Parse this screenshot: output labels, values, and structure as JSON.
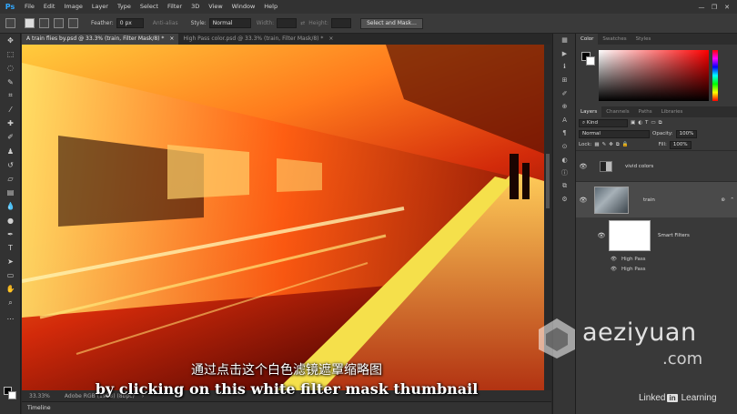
{
  "app": {
    "logo": "Ps",
    "menu": [
      "File",
      "Edit",
      "Image",
      "Layer",
      "Type",
      "Select",
      "Filter",
      "3D",
      "View",
      "Window",
      "Help"
    ],
    "window_controls": [
      "—",
      "❐",
      "✕"
    ]
  },
  "options": {
    "feather_label": "Feather:",
    "feather_value": "0 px",
    "anti_alias": "Anti-alias",
    "style_label": "Style:",
    "style_value": "Normal",
    "width_label": "Width:",
    "height_label": "Height:",
    "select_mask_label": "Select and Mask..."
  },
  "tools": [
    "move-icon",
    "marquee-icon",
    "lasso-icon",
    "quick-select-icon",
    "crop-icon",
    "eyedropper-icon",
    "healing-icon",
    "brush-icon",
    "clone-stamp-icon",
    "history-brush-icon",
    "eraser-icon",
    "gradient-icon",
    "blur-icon",
    "dodge-icon",
    "pen-icon",
    "type-icon",
    "path-select-icon",
    "shape-icon",
    "hand-icon",
    "zoom-icon",
    "more-icon"
  ],
  "documents": {
    "tabs": [
      {
        "label": "A train flies by.psd @ 33.3% (train, Filter Mask/8) *",
        "close": "×",
        "active": true
      },
      {
        "label": "High Pass color.psd @ 33.3% (train, Filter Mask/8) *",
        "close": "×",
        "active": false
      }
    ]
  },
  "status": {
    "zoom": "33.33%",
    "profile": "Adobe RGB (1998) (8bpc)",
    "arrow": "›"
  },
  "timeline_label": "Timeline",
  "color_panel": {
    "tabs": [
      "Color",
      "Swatches",
      "Styles"
    ],
    "foreground": "#000000",
    "background": "#ffffff"
  },
  "layers_panel": {
    "tabs": [
      "Layers",
      "Channels",
      "Paths",
      "Libraries"
    ],
    "kind_label": "Kind",
    "blend_mode": "Normal",
    "opacity_label": "Opacity:",
    "opacity_value": "100%",
    "lock_label": "Lock:",
    "fill_label": "Fill:",
    "fill_value": "100%",
    "layers": [
      {
        "name": "vivid colors",
        "visible": true,
        "type": "adjustment"
      },
      {
        "name": "train",
        "visible": true,
        "type": "smart-object"
      }
    ],
    "smart_filters_label": "Smart Filters",
    "filters": [
      "High Pass",
      "High Pass"
    ]
  },
  "subtitles": {
    "cn": "通过点击这个白色滤镜遮罩缩略图",
    "en": "by clicking on this white filter mask thumbnail"
  },
  "watermarks": {
    "site": "aeziyuan",
    "tld": ".com",
    "linkedin_prefix": "Linked",
    "linkedin_in": "in",
    "linkedin_suffix": "Learning"
  },
  "colors": {
    "ps_blue": "#31a8ff",
    "ui_dark": "#323232",
    "canvas_hot": "#ff7a1c"
  }
}
